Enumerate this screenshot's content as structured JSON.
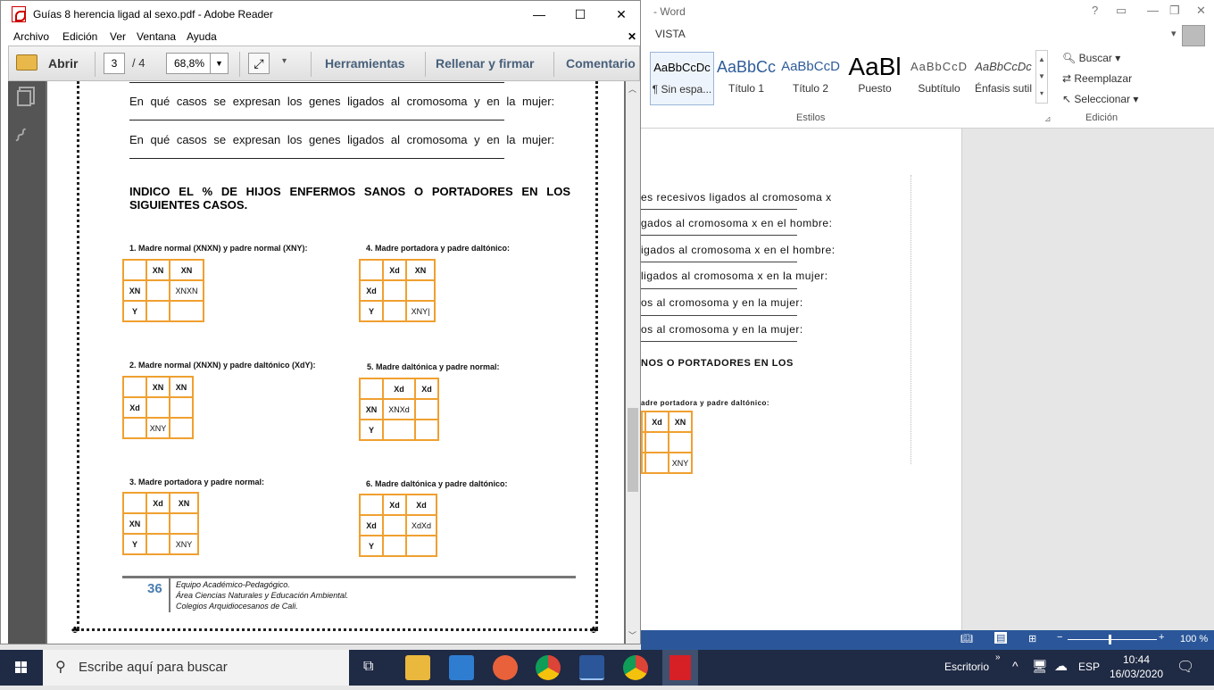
{
  "word": {
    "title": "- Word",
    "tab": "VISTA",
    "styles": [
      {
        "preview": "AaBbCcDc",
        "name": "¶ Sin espa..."
      },
      {
        "preview": "AaBbCc",
        "name": "Título 1"
      },
      {
        "preview": "AaBbCcD",
        "name": "Título 2"
      },
      {
        "preview": "AaBl",
        "name": "Puesto"
      },
      {
        "preview": "AaBbCcD",
        "name": "Subtítulo"
      },
      {
        "preview": "AaBbCcDc",
        "name": "Énfasis sutil"
      }
    ],
    "group_styles": "Estilos",
    "group_edit": "Edición",
    "edit_buttons": [
      "Buscar",
      "Reemplazar",
      "Seleccionar"
    ],
    "doc_lines": [
      "es recesivos ligados al cromosoma x",
      "gados al cromosoma x en el hombre:",
      "igados al cromosoma x en el hombre:",
      " ligados al cromosoma x en la mujer:",
      "os   al   cromosoma   y   en   la   mujer:",
      "os   al   cromosoma   y   en   la   mujer:",
      "NOS   O   PORTADORES   EN   LOS"
    ],
    "doc_case_label": "adre portadora y padre daltónico:",
    "zoom": "100 %"
  },
  "reader": {
    "title": "Guías 8 herencia ligad al sexo.pdf - Adobe Reader",
    "menu": [
      "Archivo",
      "Edición",
      "Ver",
      "Ventana",
      "Ayuda"
    ],
    "open_label": "Abrir",
    "page_current": "3",
    "page_total": "/ 4",
    "zoom": "68,8%",
    "tools": [
      "Herramientas",
      "Rellenar y firmar",
      "Comentario"
    ]
  },
  "pdf": {
    "questions": [
      "En qué casos se expresan los genes ligados al cromosoma y en la mujer:",
      "En qué casos se expresan los genes ligados al cromosoma y en la mujer:"
    ],
    "heading": "INDICO EL % DE HIJOS ENFERMOS SANOS O PORTADORES EN LOS SIGUIENTES CASOS.",
    "cases": [
      {
        "label": "1. Madre normal  (XNXN) y padre normal (XNY):",
        "cells": [
          [
            "",
            "XN",
            "XN"
          ],
          [
            "XN",
            "",
            "XNXN"
          ],
          [
            "Y",
            "",
            ""
          ]
        ]
      },
      {
        "label": "4. Madre portadora y padre daltónico:",
        "cells": [
          [
            "",
            "Xd",
            "XN"
          ],
          [
            "Xd",
            "",
            ""
          ],
          [
            "Y",
            "",
            "XNY|"
          ]
        ]
      },
      {
        "label": "2. Madre normal (XNXN) y padre daltónico (XdY):",
        "cells": [
          [
            "",
            "XN",
            "XN"
          ],
          [
            "Xd",
            "",
            ""
          ],
          [
            "",
            "XNY",
            ""
          ]
        ]
      },
      {
        "label": "5. Madre daltónica y padre normal:",
        "cells": [
          [
            "",
            "Xd",
            "Xd"
          ],
          [
            "XN",
            "XNXd",
            ""
          ],
          [
            "Y",
            "",
            ""
          ]
        ]
      },
      {
        "label": "3. Madre portadora y padre normal:",
        "cells": [
          [
            "",
            "Xd",
            "XN"
          ],
          [
            "XN",
            "",
            ""
          ],
          [
            "Y",
            "",
            "XNY"
          ]
        ]
      },
      {
        "label": "6. Madre daltónica y padre daltónico:",
        "cells": [
          [
            "",
            "Xd",
            "Xd"
          ],
          [
            "Xd",
            "",
            "XdXd"
          ],
          [
            "Y",
            "",
            ""
          ]
        ]
      }
    ],
    "footer_num": "36",
    "footer_lines": [
      "Equipo Académico-Pedagógico.",
      "Área Ciencias Naturales y Educación Ambiental.",
      "Colegios Arquidiocesanos de Cali."
    ]
  },
  "taskbar": {
    "search_placeholder": "Escribe aquí para buscar",
    "desktop_label": "Escritorio",
    "lang": "ESP",
    "time": "10:44",
    "date": "16/03/2020"
  },
  "colors": {
    "word_blue": "#2b579a",
    "grid_orange": "#f0a030",
    "reader_link": "#47607a",
    "taskbar": "#1f2a44"
  }
}
